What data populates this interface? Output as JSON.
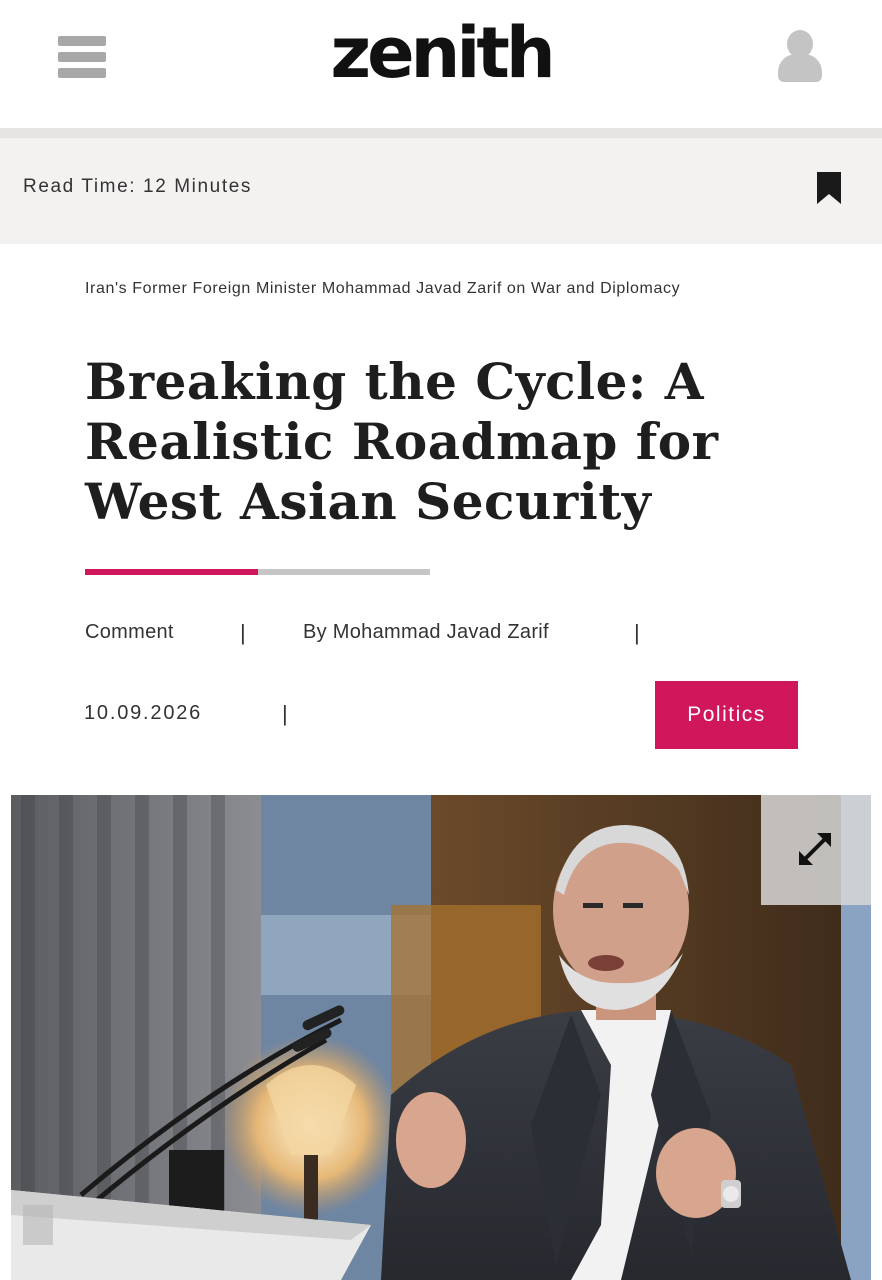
{
  "header": {
    "logo_text": "zenith",
    "menu_icon": "hamburger-menu-icon",
    "account_icon": "user-icon"
  },
  "info_bar": {
    "read_time": "Read Time: 12 Minutes",
    "bookmark_icon": "bookmark-icon"
  },
  "article": {
    "kicker": "Iran's Former Foreign Minister Mohammad Javad Zarif on War and Diplomacy",
    "title": "Breaking the Cycle: A Realistic Roadmap for West Asian Security",
    "reading_progress": 0.5,
    "type": "Comment",
    "author": "By Mohammad Javad Zarif",
    "separator": "|",
    "date": "10.09.2026",
    "category": "Politics"
  },
  "hero": {
    "expand_icon": "expand-icon"
  },
  "colors": {
    "accent": "#d0175b",
    "progress_track": "#c6c6c6",
    "info_bar_bg": "#f3f2f1"
  }
}
